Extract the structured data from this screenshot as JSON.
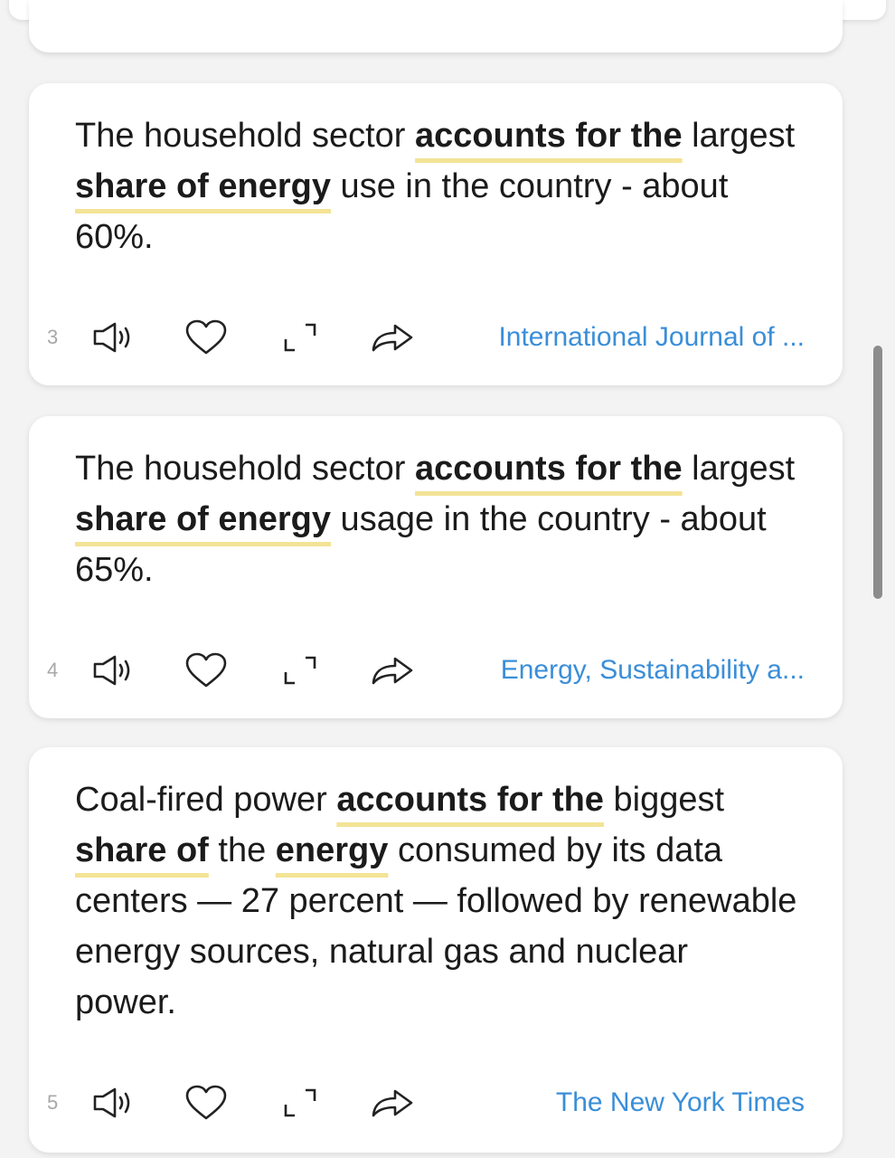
{
  "cards": [
    {
      "index": "3",
      "parts": [
        {
          "text": "The household sector "
        },
        {
          "text": "accounts for the",
          "hl": true
        },
        {
          "text": " largest "
        },
        {
          "text": "share of energy",
          "hl": true
        },
        {
          "text": " use in the country - about 60%."
        }
      ],
      "source": "International Journal of ..."
    },
    {
      "index": "4",
      "parts": [
        {
          "text": "The household sector "
        },
        {
          "text": "accounts for the",
          "hl": true
        },
        {
          "text": " largest "
        },
        {
          "text": "share of energy",
          "hl": true
        },
        {
          "text": " usage in the country - about 65%."
        }
      ],
      "source": "Energy, Sustainability a..."
    },
    {
      "index": "5",
      "parts": [
        {
          "text": "Coal-fired power "
        },
        {
          "text": "accounts for the",
          "hl": true
        },
        {
          "text": " biggest "
        },
        {
          "text": "share of",
          "hl": true
        },
        {
          "text": " the "
        },
        {
          "text": "energy",
          "hl": true
        },
        {
          "text": " consumed by its data centers — 27 percent — followed by renewable energy sources, natural gas and nuclear power."
        }
      ],
      "source": "The New York Times"
    }
  ],
  "icons": {
    "listen": "speaker-icon",
    "like": "heart-icon",
    "expand": "expand-icon",
    "share": "share-icon"
  },
  "colors": {
    "highlight_underline": "#f3e396",
    "source_link": "#3a8ed8",
    "index_number": "#a8a8a8",
    "background": "#f3f3f4"
  }
}
